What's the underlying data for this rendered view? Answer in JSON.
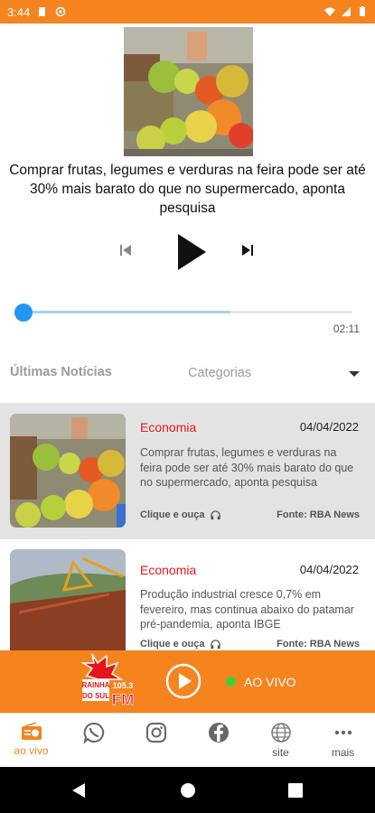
{
  "status_bar": {
    "time": "3:44"
  },
  "now_playing": {
    "title": "Comprar frutas, legumes e verduras na feira pode ser até 30% mais barato do que no supermercado, aponta pesquisa",
    "duration": "02:11",
    "progress": 0.0,
    "buffered": 0.63
  },
  "tabs": {
    "latest": "Últimas Notícias",
    "categories": "Categorias"
  },
  "news": [
    {
      "category": "Economia",
      "date": "04/04/2022",
      "text": "Comprar frutas, legumes e verduras na feira pode ser até 30% mais barato do que no supermercado, aponta pesquisa",
      "listen": "Clique e ouça",
      "source": "Fonte: RBA News"
    },
    {
      "category": "Economia",
      "date": "04/04/2022",
      "text": "Produção industrial cresce 0,7% em fevereiro, mas continua abaixo do patamar pré-pandemia, aponta IBGE",
      "listen": "Clique e ouça",
      "source": "Fonte: RBA News"
    }
  ],
  "player": {
    "live_label": "AO VIVO",
    "logo_text": [
      "RAINHA",
      "DO SUL",
      "FM",
      "105.3"
    ]
  },
  "bottom_nav": [
    {
      "label": "ao vivo",
      "icon": "radio-icon",
      "active": true
    },
    {
      "label": "",
      "icon": "whatsapp-icon"
    },
    {
      "label": "",
      "icon": "instagram-icon"
    },
    {
      "label": "",
      "icon": "facebook-icon"
    },
    {
      "label": "site",
      "icon": "globe-icon"
    },
    {
      "label": "mais",
      "icon": "more-icon"
    }
  ],
  "colors": {
    "brand": "#f5841f",
    "category": "#e5161a",
    "progress": "#2196f3",
    "live": "#3dd23d"
  }
}
